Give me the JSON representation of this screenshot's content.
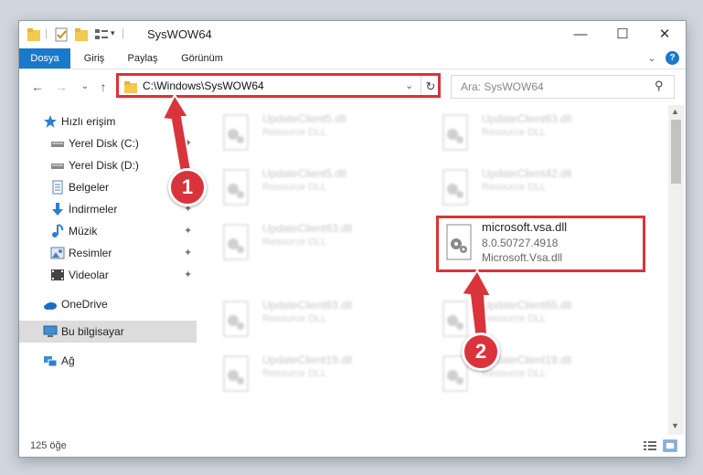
{
  "window": {
    "title": "SysWOW64",
    "controls": {
      "minimize": "—",
      "maximize": "☐",
      "close": "✕"
    }
  },
  "ribbon": {
    "tabs": [
      "Dosya",
      "Giriş",
      "Paylaş",
      "Görünüm"
    ],
    "collapse": "⌄",
    "help": "?"
  },
  "nav": {
    "back": "←",
    "forward": "→",
    "recent": "⌄",
    "up": "↑",
    "address": "C:\\Windows\\SysWOW64",
    "address_dropdown": "⌄",
    "refresh": "↻",
    "search_placeholder": "Ara: SysWOW64",
    "search_icon": "⚲"
  },
  "sidebar": {
    "items": [
      {
        "label": "Hızlı erişim",
        "icon": "star-icon",
        "pinned": false
      },
      {
        "label": "Yerel Disk (C:)",
        "icon": "drive-icon",
        "pinned": true
      },
      {
        "label": "Yerel Disk (D:)",
        "icon": "drive-icon",
        "pinned": true
      },
      {
        "label": "Belgeler",
        "icon": "documents-icon",
        "pinned": true
      },
      {
        "label": "İndirmeler",
        "icon": "downloads-icon",
        "pinned": true
      },
      {
        "label": "Müzik",
        "icon": "music-icon",
        "pinned": true
      },
      {
        "label": "Resimler",
        "icon": "pictures-icon",
        "pinned": true
      },
      {
        "label": "Videolar",
        "icon": "videos-icon",
        "pinned": true
      },
      {
        "label": "OneDrive",
        "icon": "onedrive-icon",
        "pinned": false
      },
      {
        "label": "Bu bilgisayar",
        "icon": "computer-icon",
        "pinned": false
      },
      {
        "label": "Ağ",
        "icon": "network-icon",
        "pinned": false
      }
    ],
    "pin_glyph": "✦"
  },
  "files": [
    {
      "name": "UpdateClient5.dll",
      "desc": "Resource DLL"
    },
    {
      "name": "UpdateClient63.dll",
      "desc": "Resource DLL"
    },
    {
      "name": "UpdateClient5.dll",
      "desc": "Resource DLL"
    },
    {
      "name": "UpdateClient42.dll",
      "desc": "Resource DLL"
    },
    {
      "name": "UpdateClient63.dll",
      "desc": "Resource DLL"
    },
    {
      "name": "microsoft.vsa.dll",
      "desc": "8.0.50727.4918",
      "desc2": "Microsoft.Vsa.dll"
    },
    {
      "name": "UpdateClient63.dll",
      "desc": "Resource DLL"
    },
    {
      "name": "UpdateClient65.dll",
      "desc": "Resource DLL"
    },
    {
      "name": "UpdateClient19.dll",
      "desc": "Resource DLL"
    },
    {
      "name": "UpdateClient19.dll",
      "desc": "Resource DLL"
    }
  ],
  "status": {
    "count": "125 öğe"
  },
  "annotations": {
    "badge1": "1",
    "badge2": "2"
  },
  "colors": {
    "accent": "#1979ca",
    "highlight": "#d9343b"
  }
}
